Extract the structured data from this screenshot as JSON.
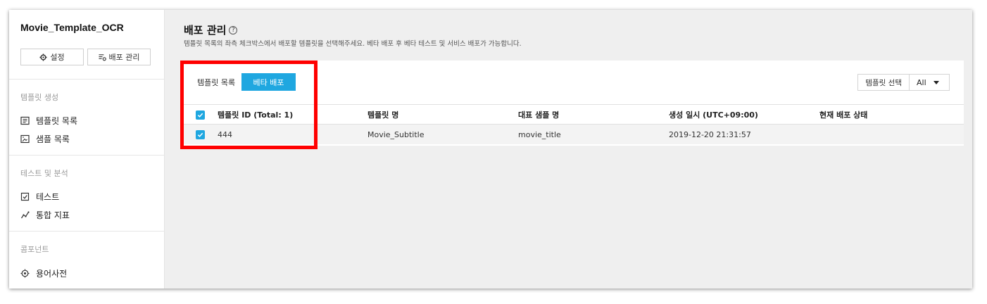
{
  "sidebar": {
    "app_title": "Movie_Template_OCR",
    "settings_label": "설정",
    "deploy_label": "배포 관리",
    "sections": [
      {
        "title": "템플릿 생성",
        "items": [
          {
            "label": "템플릿 목록",
            "icon": "list-icon"
          },
          {
            "label": "샘플 목록",
            "icon": "image-icon"
          }
        ]
      },
      {
        "title": "테스트 및 분석",
        "items": [
          {
            "label": "테스트",
            "icon": "check-doc-icon"
          },
          {
            "label": "통합 지표",
            "icon": "chart-line-icon"
          }
        ]
      },
      {
        "title": "콤포넌트",
        "items": [
          {
            "label": "용어사전",
            "icon": "target-icon"
          }
        ]
      }
    ]
  },
  "main": {
    "title": "배포 관리",
    "help": "?",
    "description": "템플릿 목록의 좌측 체크박스에서 배포할 템플릿을 선택해주세요. 베타 배포 후 베타 테스트 및 서비스 배포가 가능합니다.",
    "panel_label": "템플릿 목록",
    "beta_button": "베타 배포",
    "filter_label": "템플릿 선택",
    "filter_value": "All",
    "columns": [
      "템플릿 ID (Total: 1)",
      "템플릿 명",
      "대표 샘플 명",
      "생성 일시 (UTC+09:00)",
      "현재 배포 상태"
    ],
    "rows": [
      {
        "id": "444",
        "name": "Movie_Subtitle",
        "sample": "movie_title",
        "created": "2019-12-20 21:31:57",
        "status": ""
      }
    ]
  },
  "colors": {
    "accent": "#1fa7e0",
    "highlight": "#ff0000"
  }
}
